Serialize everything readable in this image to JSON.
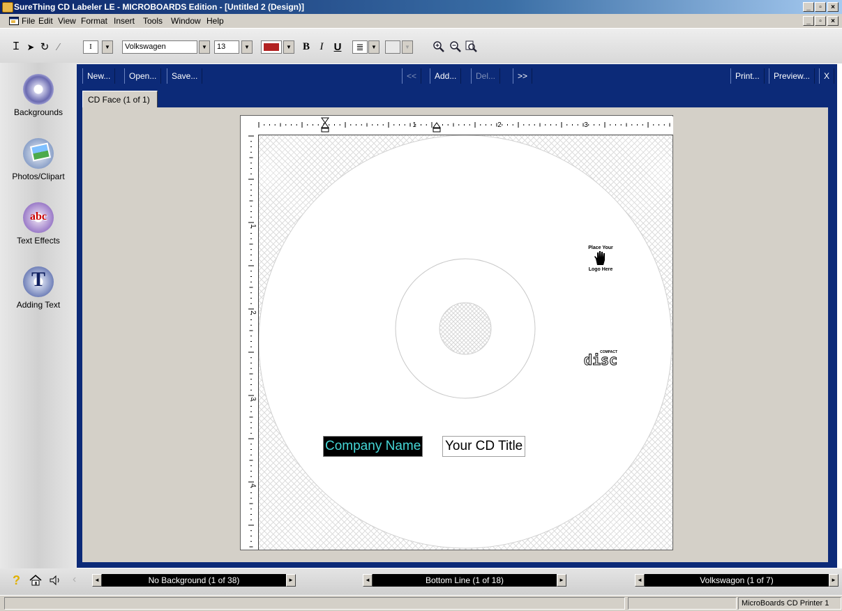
{
  "window": {
    "title": "SureThing CD Labeler LE - MICROBOARDS Edition - [Untitled 2 (Design)]"
  },
  "menu": {
    "items": [
      "File",
      "Edit",
      "View",
      "Format",
      "Insert",
      "Tools",
      "Window",
      "Help"
    ]
  },
  "toolbar": {
    "font_name": "Volkswagen",
    "font_size": "13",
    "text_color": "#b22222",
    "bold_glyph": "B",
    "italic_glyph": "I",
    "underline_glyph": "U",
    "tools": [
      "text-tool-icon",
      "pointer-icon",
      "rotate-icon",
      "eyedropper-icon"
    ],
    "zoom": [
      "zoom-in-icon",
      "zoom-out-icon",
      "zoom-fit-icon"
    ]
  },
  "sidebar": {
    "items": [
      {
        "label": "Backgrounds",
        "icon": "backgrounds-icon"
      },
      {
        "label": "Photos/Clipart",
        "icon": "photos-clipart-icon"
      },
      {
        "label": "Text Effects",
        "icon": "text-effects-icon"
      },
      {
        "label": "Adding Text",
        "icon": "adding-text-icon"
      }
    ]
  },
  "navbar": {
    "new": "New...",
    "open": "Open...",
    "save": "Save...",
    "prev": "<<",
    "add": "Add...",
    "del": "Del...",
    "next": ">>",
    "print": "Print...",
    "preview": "Preview...",
    "close": "X"
  },
  "tab": {
    "label": "CD Face (1 of 1)"
  },
  "ruler": {
    "h_numbers": [
      "1",
      "2",
      "3"
    ],
    "v_numbers": [
      "1",
      "2",
      "3",
      "4"
    ]
  },
  "canvas": {
    "logo_top": "Place Your",
    "logo_bottom": "Logo Here",
    "compact_text": "COMPACT",
    "disc_text": "disc",
    "company_name": "Company Name",
    "cd_title": "Your CD Title",
    "company_color": "#45d6d6"
  },
  "bottom": {
    "background_scroller": "No Background (1 of 38)",
    "layout_scroller": "Bottom Line (1 of 18)",
    "font_scroller": "Volkswagon (1 of 7)",
    "icons": [
      "help-icon",
      "home-icon",
      "sound-icon",
      "back-icon"
    ]
  },
  "status": {
    "printer": "MicroBoards CD Printer 1"
  }
}
